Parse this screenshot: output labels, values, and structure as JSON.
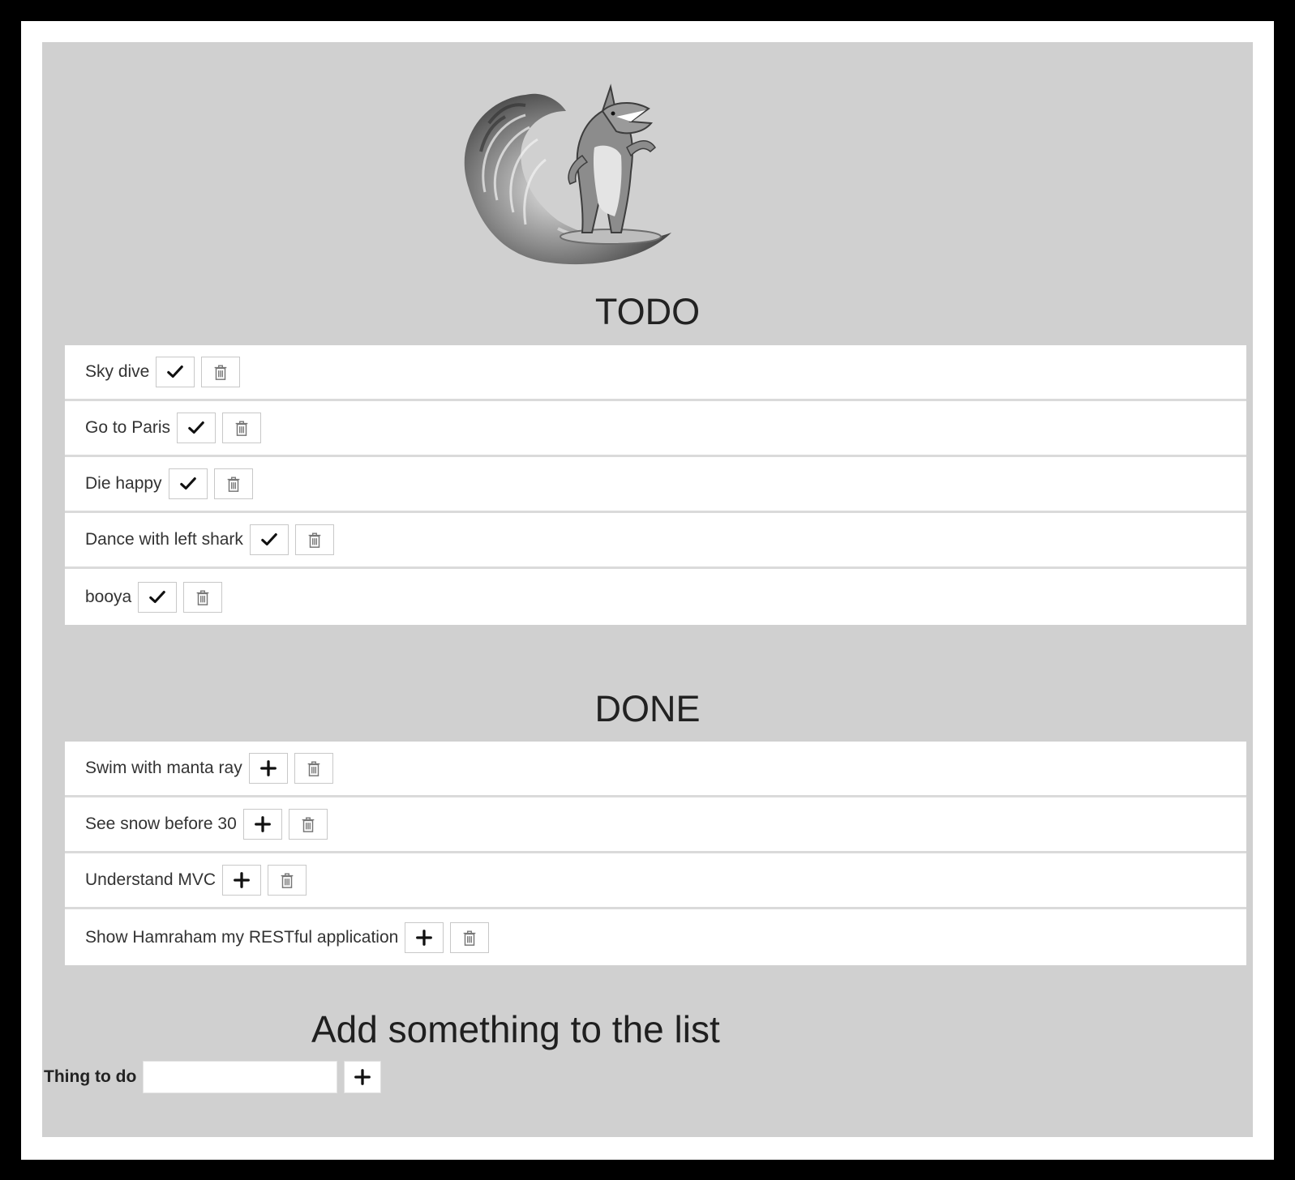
{
  "sections": {
    "todo_title": "TODO",
    "done_title": "DONE"
  },
  "todo": [
    {
      "label": "Sky dive"
    },
    {
      "label": "Go to Paris"
    },
    {
      "label": "Die happy"
    },
    {
      "label": "Dance with left shark"
    },
    {
      "label": "booya"
    }
  ],
  "done": [
    {
      "label": "Swim with manta ray"
    },
    {
      "label": "See snow before 30"
    },
    {
      "label": "Understand MVC"
    },
    {
      "label": "Show Hamraham my RESTful application"
    }
  ],
  "add": {
    "title": "Add something to the list",
    "label": "Thing to do",
    "input_value": ""
  },
  "icons": {
    "complete": "check-icon",
    "restore": "plus-icon",
    "delete": "trash-icon",
    "logo": "surfing-shark-logo"
  },
  "colors": {
    "background": "#d0d0d0",
    "panel": "#ffffff",
    "frame": "#000000"
  }
}
